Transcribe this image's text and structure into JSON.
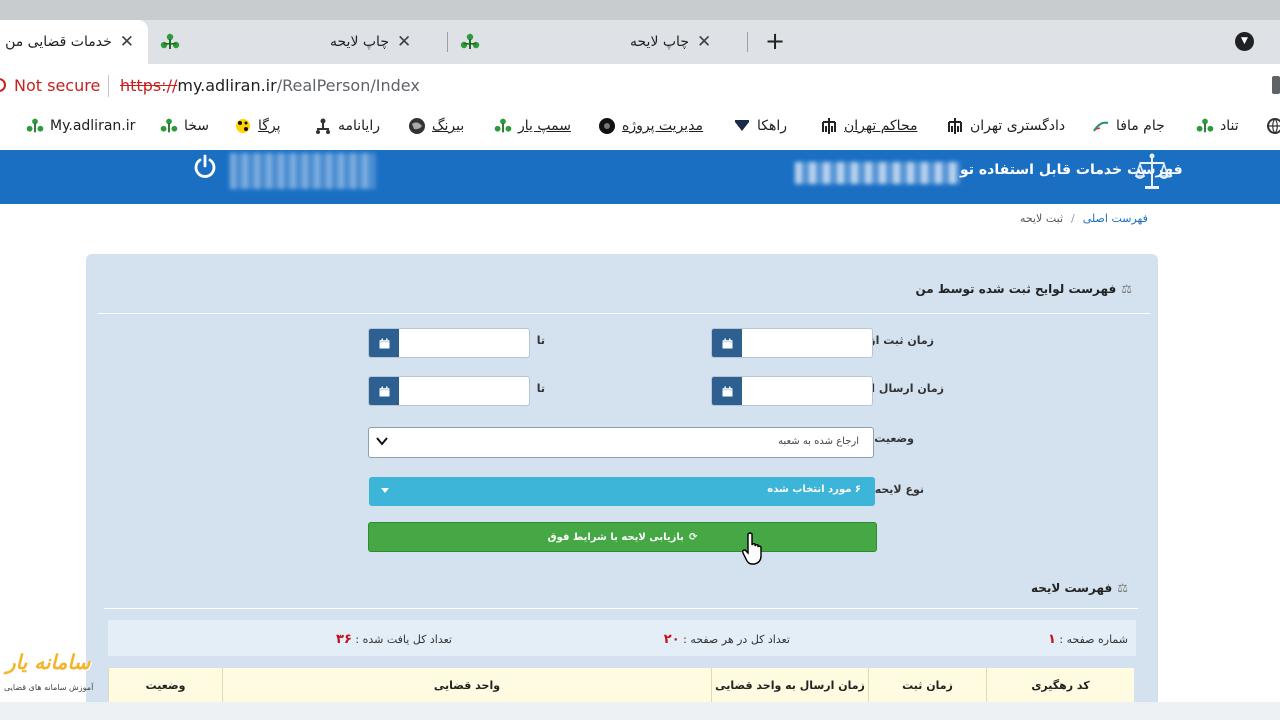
{
  "browser": {
    "tabs": [
      {
        "title": "خدمات قضایی من",
        "active": true
      },
      {
        "title": "چاپ لایحه",
        "active": false
      },
      {
        "title": "چاپ لایحه",
        "active": false
      }
    ],
    "new_tab_symbol": "+",
    "tab_close_symbol": "✕",
    "security_label": "Not secure",
    "url_scheme": "https://",
    "url_host": "my.adliran.ir",
    "url_path": "/RealPerson/Index",
    "bookmarks": [
      {
        "label": "تناد",
        "icon": "globe-icon"
      },
      {
        "label": "جام مافا",
        "icon": "leaf-icon"
      },
      {
        "label": "دادگستری تهران",
        "icon": "building-icon"
      },
      {
        "label": "محاکم تهران",
        "icon": "building-icon"
      },
      {
        "label": "راهکا",
        "icon": "shield-icon"
      },
      {
        "label": "مدیریت پروژه",
        "icon": "circle-logo-icon"
      },
      {
        "label": "سمپ یار",
        "icon": "tree-icon"
      },
      {
        "label": "بیرنگ",
        "icon": "tree-icon"
      },
      {
        "label": "رایانامه",
        "icon": "globe-icon"
      },
      {
        "label": "پرگا",
        "icon": "org-icon"
      },
      {
        "label": "سخا",
        "icon": "flower-icon"
      },
      {
        "label": "My.adliran.ir",
        "icon": "tree-icon"
      }
    ]
  },
  "site": {
    "header_title": "فهرست خدمات قابل استفاده تو",
    "breadcrumb": {
      "home": "فهرست اصلی",
      "current": "ثبت لایحه"
    }
  },
  "panel": {
    "title": "فهرست لوایح ثبت شده توسط من",
    "fields": {
      "register_from": "زمان ثبت از",
      "send_from": "زمان ارسال از",
      "to": "تا",
      "status": "وضعیت",
      "type": "نوع لایحه"
    },
    "status_value": "ارجاع شده به شعبه",
    "type_value": "۶ مورد انتخاب شده",
    "search_button": "بازیابی لایحه با شرایط فوق"
  },
  "list": {
    "title": "فهرست لایحه",
    "page_number_label": "شماره صفحه :",
    "page_number": "۱",
    "per_page_label": "تعداد کل در هر صفحه :",
    "per_page": "۲۰",
    "total_label": "تعداد کل یافت شده :",
    "total": "۳۶",
    "columns": [
      "کد رهگیری",
      "زمان ثبت",
      "زمان ارسال به واحد قضایی",
      "واحد قضایی",
      "وضعیت"
    ]
  },
  "watermark": {
    "brand": "سامانه یار",
    "subtitle": "آموزش سامانه های قضایی"
  },
  "colors": {
    "header_blue": "#1a6fc3",
    "panel_bg": "#d3e2ee",
    "select_cyan": "#3cb5d9",
    "button_green": "#45a845",
    "calendar_blue": "#2d5f90",
    "number_red": "#c0121b"
  }
}
